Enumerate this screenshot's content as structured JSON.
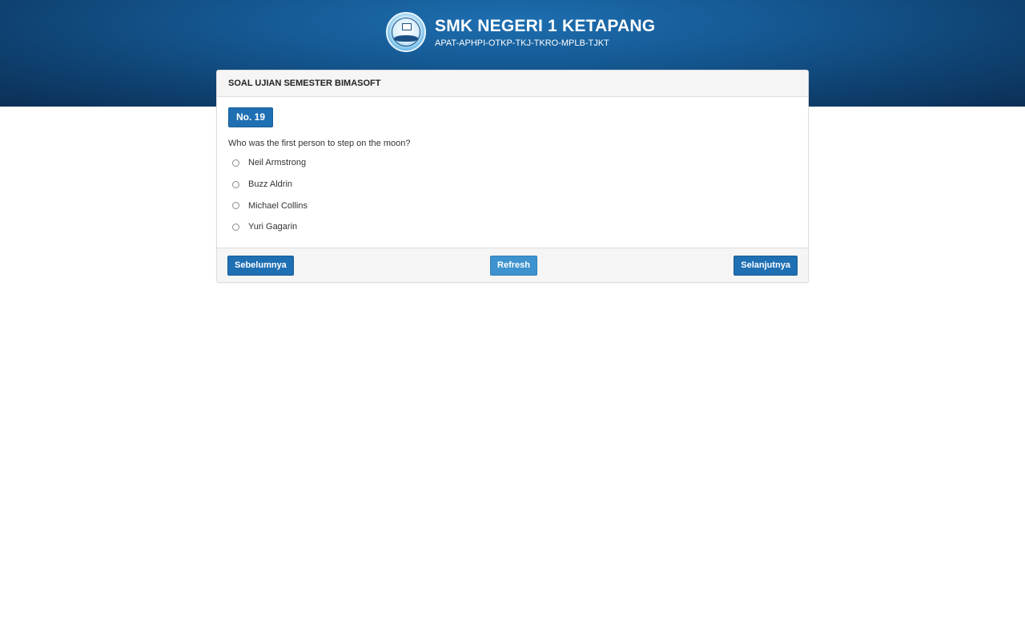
{
  "header": {
    "school_name": "SMK NEGERI 1 KETAPANG",
    "programs": "APAT-APHPI-OTKP-TKJ-TKRO-MPLB-TJKT",
    "logo_icon": "school-emblem-icon"
  },
  "exam": {
    "title": "SOAL UJIAN SEMESTER BIMASOFT",
    "question_number": "No. 19",
    "question_text": "Who was the first person to step on the moon?",
    "options": [
      {
        "label": "Neil Armstrong"
      },
      {
        "label": "Buzz Aldrin"
      },
      {
        "label": "Michael Collins"
      },
      {
        "label": "Yuri Gagarin"
      }
    ]
  },
  "footer": {
    "prev_label": "Sebelumnya",
    "refresh_label": "Refresh",
    "next_label": "Selanjutnya"
  },
  "colors": {
    "header_band": "#155a94",
    "primary_button": "#1f6fb3",
    "refresh_button": "#3e93cf"
  }
}
